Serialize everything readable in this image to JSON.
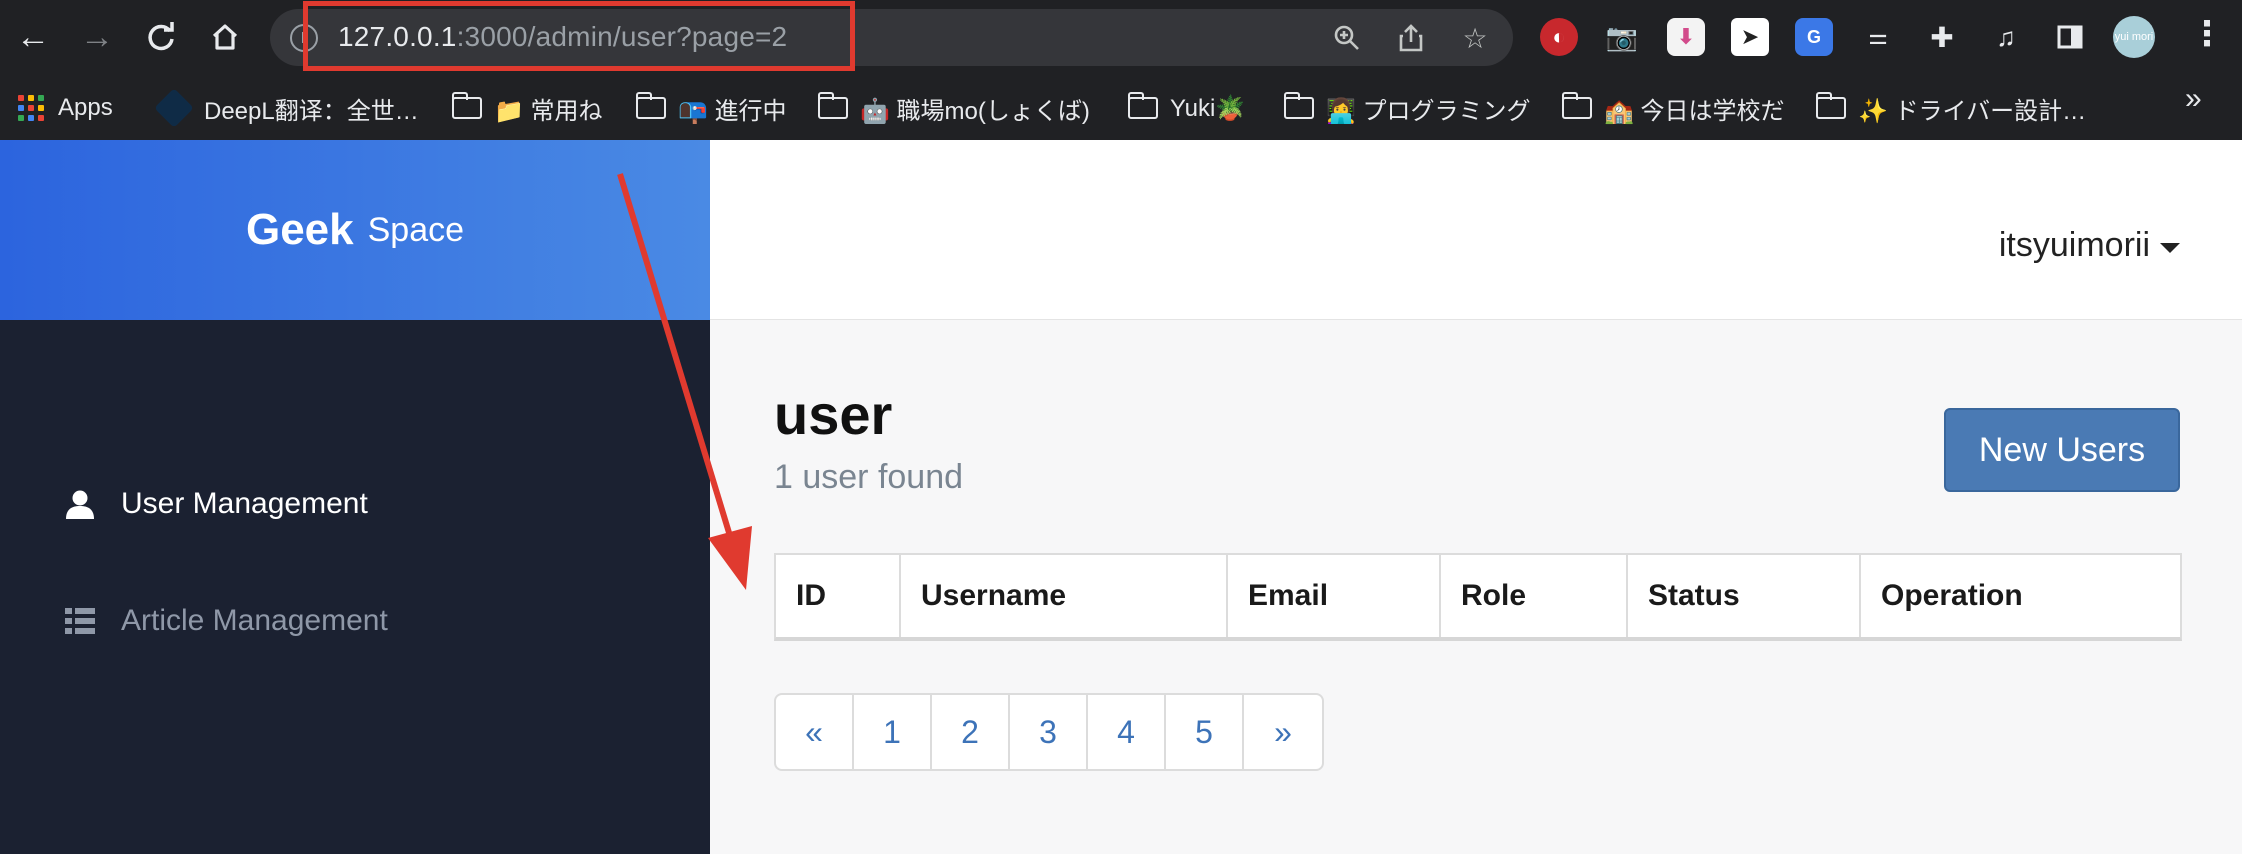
{
  "browser": {
    "url_host": "127.0.0.1",
    "url_path": ":3000/admin/user?page=2",
    "bookmarks": [
      {
        "label": "Apps",
        "icon": "apps-grid-icon"
      },
      {
        "label": "DeepL翻译：全世…",
        "icon": "deepl-icon"
      },
      {
        "label": "📁 常用ね",
        "icon": "folder-icon"
      },
      {
        "label": "📭 進行中",
        "icon": "folder-icon"
      },
      {
        "label": "🤖 職場mo(しょくば)",
        "icon": "folder-icon"
      },
      {
        "label": "Yuki🪴",
        "icon": "folder-icon"
      },
      {
        "label": "👩‍💻 プログラミング",
        "icon": "folder-icon"
      },
      {
        "label": "🏫 今日は学校だ",
        "icon": "folder-icon"
      },
      {
        "label": "✨ ドライバー設計…",
        "icon": "folder-icon"
      }
    ],
    "bookmarks_overflow": "»",
    "profile_initials": "yui mori"
  },
  "app": {
    "brand_bold": "Geek",
    "brand_light": "Space",
    "sidebar": [
      {
        "label": "User Management",
        "icon": "user-icon",
        "active": true
      },
      {
        "label": "Article Management",
        "icon": "list-icon",
        "active": false
      }
    ],
    "user_menu": "itsyuimorii"
  },
  "main": {
    "title": "user",
    "subtitle": "1 user found",
    "new_button": "New Users",
    "columns": [
      "ID",
      "Username",
      "Email",
      "Role",
      "Status",
      "Operation"
    ],
    "pagination": [
      "«",
      "1",
      "2",
      "3",
      "4",
      "5",
      "»"
    ]
  },
  "colors": {
    "annotation": "#e03a2f",
    "brand_gradient_start": "#2c64de",
    "brand_gradient_end": "#4a8ae4",
    "sidebar_bg": "#1b2131",
    "primary_button": "#4a7ab4",
    "link": "#3d73b8"
  }
}
